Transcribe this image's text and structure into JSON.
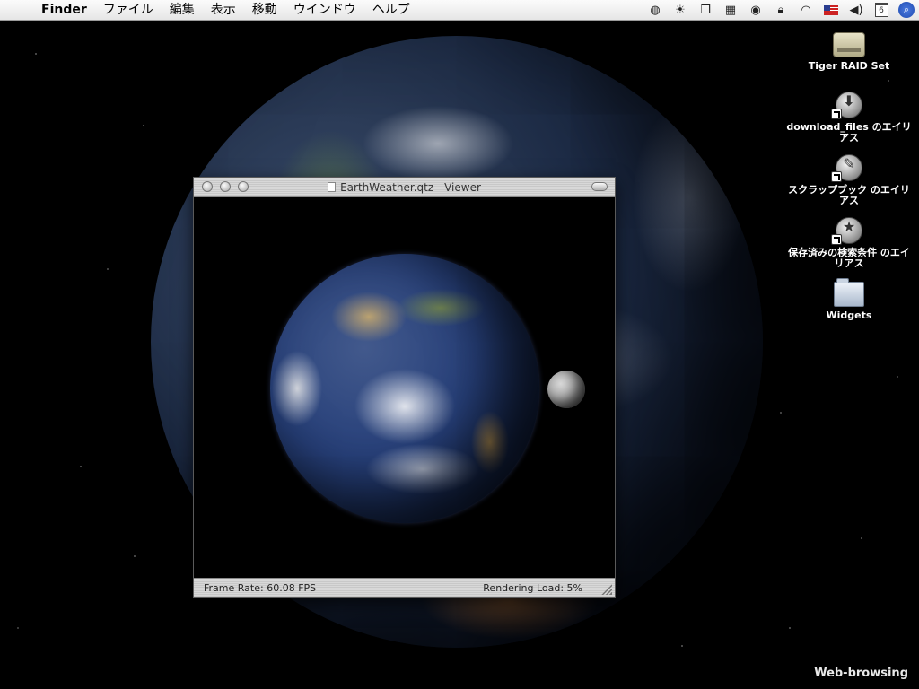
{
  "menubar": {
    "app": "Finder",
    "menus": [
      "ファイル",
      "編集",
      "表示",
      "移動",
      "ウインドウ",
      "ヘルプ"
    ],
    "calendar_day": "6"
  },
  "desktop_icons": [
    {
      "label": "Tiger RAID Set",
      "icon": "hard-drive-icon"
    },
    {
      "label": "download_files のエイリアス",
      "icon": "download-alias-icon"
    },
    {
      "label": "スクラップブック のエイリアス",
      "icon": "scrapbook-alias-icon"
    },
    {
      "label": "保存済みの検索条件 のエイリアス",
      "icon": "saved-search-alias-icon"
    },
    {
      "label": "Widgets",
      "icon": "folder-icon"
    }
  ],
  "viewer": {
    "title": "EarthWeather.qtz - Viewer",
    "frame_rate_label": "Frame Rate:",
    "frame_rate_value": "60.08 FPS",
    "rendering_load_label": "Rendering Load:",
    "rendering_load_value": "5%"
  },
  "desktop_label": "Web-browsing"
}
